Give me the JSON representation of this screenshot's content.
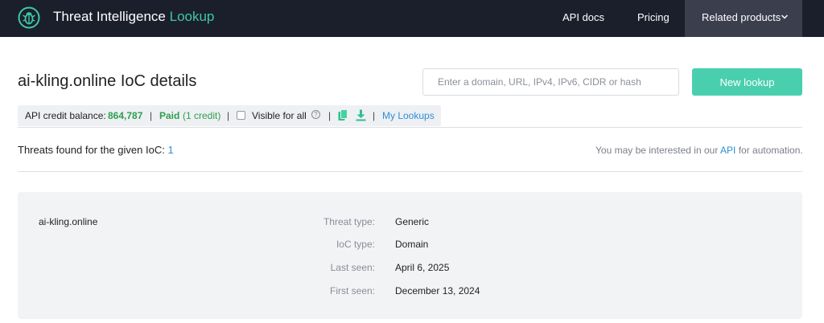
{
  "header": {
    "brand_main": "Threat Intelligence",
    "brand_accent": "Lookup",
    "nav": {
      "api_docs": "API docs",
      "pricing": "Pricing",
      "related_products": "Related products"
    }
  },
  "title_row": {
    "title": "ai-kling.online IoC details",
    "search_placeholder": "Enter a domain, URL, IPv4, IPv6, CIDR or hash",
    "new_lookup_label": "New lookup"
  },
  "credit_bar": {
    "balance_label": "API credit balance:",
    "balance_value": "864,787",
    "sep": "|",
    "paid_label": "Paid",
    "paid_credit": "(1 credit)",
    "visible_label": "Visible for all",
    "help_glyph": "?",
    "my_lookups": "My Lookups"
  },
  "threats": {
    "label": "Threats found for the given IoC:",
    "count": "1"
  },
  "automation": {
    "prefix": "You may be interested in our",
    "link": "API",
    "suffix": "for automation."
  },
  "details": {
    "domain": "ai-kling.online",
    "rows": [
      {
        "label": "Threat type:",
        "value": "Generic"
      },
      {
        "label": "IoC type:",
        "value": "Domain"
      },
      {
        "label": "Last seen:",
        "value": "April 6, 2025"
      },
      {
        "label": "First seen:",
        "value": "December 13, 2024"
      }
    ]
  },
  "colors": {
    "header_bg": "#1b1f2c",
    "accent": "#3ec9a7",
    "button": "#49cfae",
    "link": "#2d8fd6",
    "green": "#2e9e4f"
  },
  "icons": [
    "bug-logo-icon",
    "chevron-down-icon",
    "help-icon",
    "copy-icon",
    "download-icon"
  ]
}
